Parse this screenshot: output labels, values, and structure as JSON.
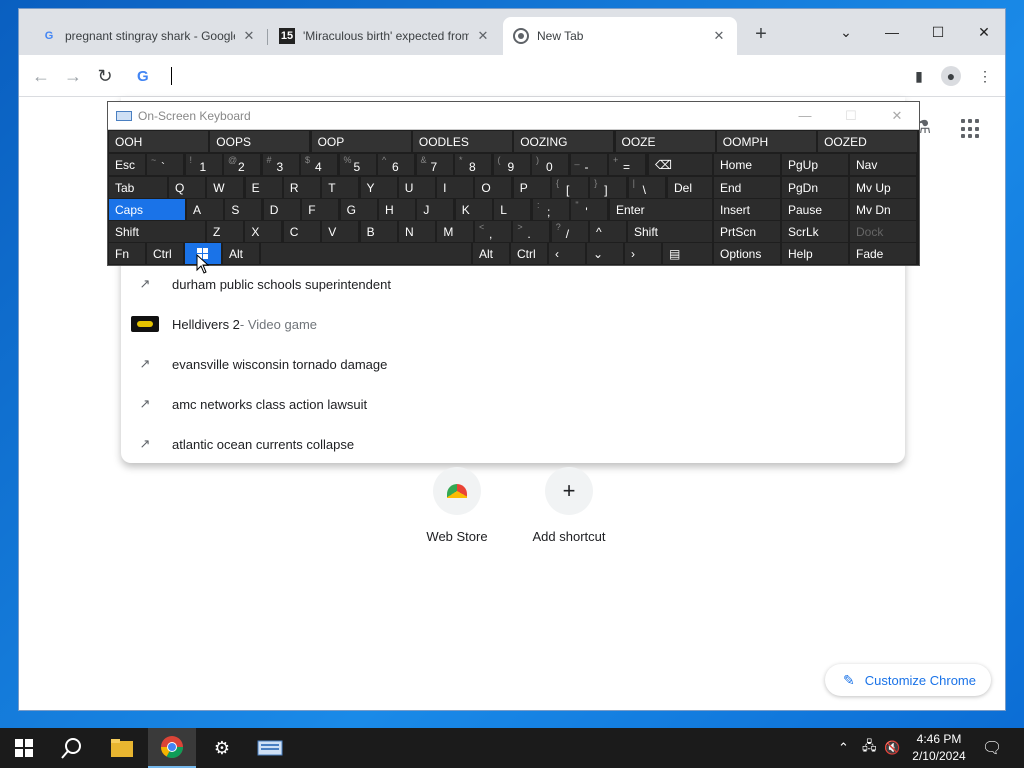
{
  "browser": {
    "tabs": [
      {
        "title": "pregnant stingray shark - Google",
        "favicon": "google-g-icon"
      },
      {
        "title": "'Miraculous birth' expected from",
        "favicon": "channel-15-icon"
      },
      {
        "title": "New Tab",
        "favicon": "chrome-icon"
      }
    ],
    "omnibox_value": ""
  },
  "suggestions": [
    {
      "text": "durham public schools superintendent",
      "icon": "trending-icon"
    },
    {
      "text": "Helldivers 2",
      "sub": " - Video game",
      "icon": "thumbnail"
    },
    {
      "text": "evansville wisconsin tornado damage",
      "icon": "trending-icon"
    },
    {
      "text": "amc networks class action lawsuit",
      "icon": "trending-icon"
    },
    {
      "text": "atlantic ocean currents collapse",
      "icon": "trending-icon"
    }
  ],
  "shortcuts": [
    {
      "label": "Web Store"
    },
    {
      "label": "Add shortcut"
    }
  ],
  "customize_label": "Customize Chrome",
  "osk": {
    "title": "On-Screen Keyboard",
    "predictions": [
      "OOH",
      "OOPS",
      "OOP",
      "OODLES",
      "OOZING",
      "OOZE",
      "OOMPH",
      "OOZED"
    ],
    "row1": {
      "esc": "Esc",
      "nums": [
        [
          "~",
          "`"
        ],
        [
          "!",
          "1"
        ],
        [
          "@",
          "2"
        ],
        [
          "#",
          "3"
        ],
        [
          "$",
          "4"
        ],
        [
          "%",
          "5"
        ],
        [
          "^",
          "6"
        ],
        [
          "&",
          "7"
        ],
        [
          "*",
          "8"
        ],
        [
          "(",
          "9"
        ],
        [
          ")",
          "0"
        ],
        [
          "_",
          "-"
        ],
        [
          "+",
          "="
        ]
      ]
    },
    "row2": {
      "tab": "Tab",
      "letters": [
        "Q",
        "W",
        "E",
        "R",
        "T",
        "Y",
        "U",
        "I",
        "O",
        "P"
      ],
      "brackets": [
        [
          "{",
          "["
        ],
        [
          "}",
          "]"
        ],
        [
          "|",
          "\\"
        ]
      ],
      "del": "Del"
    },
    "row3": {
      "caps": "Caps",
      "letters": [
        "A",
        "S",
        "D",
        "F",
        "G",
        "H",
        "J",
        "K",
        "L"
      ],
      "punct": [
        [
          ":",
          ";"
        ],
        [
          "\"",
          "'"
        ]
      ],
      "enter": "Enter"
    },
    "row4": {
      "shift": "Shift",
      "letters": [
        "Z",
        "X",
        "C",
        "V",
        "B",
        "N",
        "M"
      ],
      "punct": [
        [
          "<",
          ","
        ],
        [
          ">",
          "."
        ],
        [
          "?",
          "/"
        ]
      ],
      "shift_r": "Shift"
    },
    "row5": {
      "fn": "Fn",
      "ctrl": "Ctrl",
      "alt": "Alt",
      "alt_r": "Alt",
      "ctrl_r": "Ctrl"
    },
    "nav": [
      [
        "Home",
        "PgUp",
        "Nav"
      ],
      [
        "End",
        "PgDn",
        "Mv Up"
      ],
      [
        "Insert",
        "Pause",
        "Mv Dn"
      ],
      [
        "PrtScn",
        "ScrLk",
        "Dock"
      ],
      [
        "Options",
        "Help",
        "Fade"
      ]
    ]
  },
  "taskbar": {
    "time": "4:46 PM",
    "date": "2/10/2024"
  }
}
